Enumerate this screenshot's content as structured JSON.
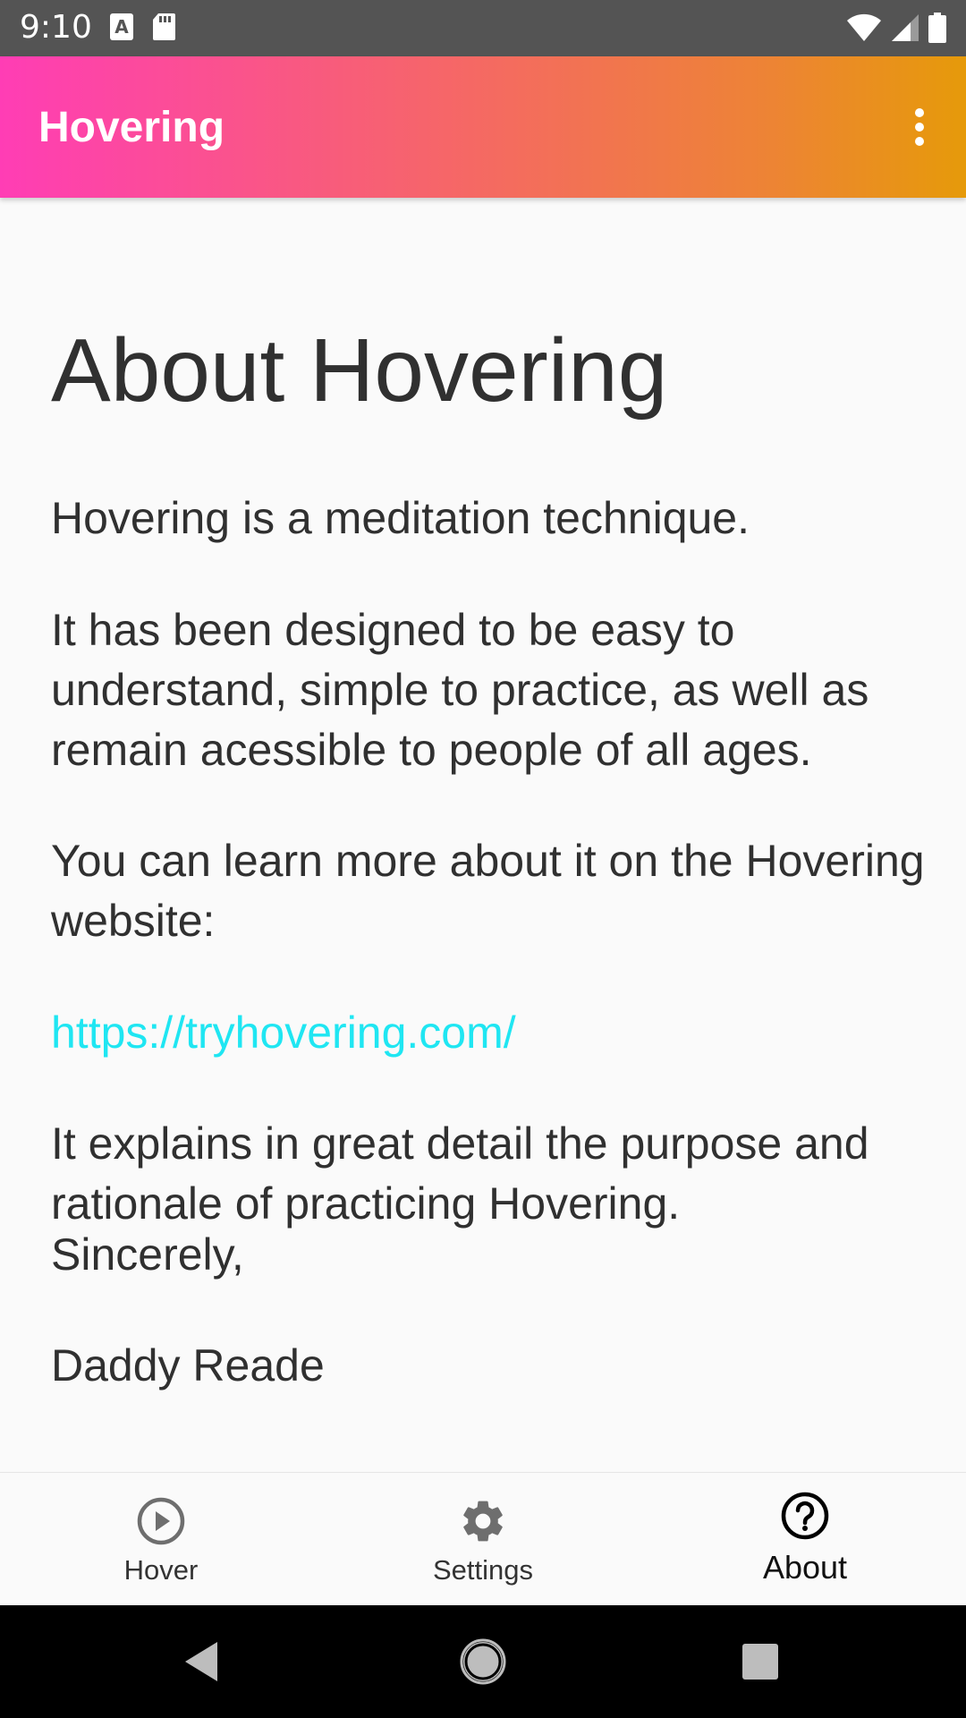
{
  "status_bar": {
    "time": "9:10",
    "icons_left": [
      "text-a-icon",
      "sd-card-icon"
    ],
    "icons_right": [
      "wifi-icon",
      "cell-signal-icon",
      "battery-icon"
    ]
  },
  "app_bar": {
    "title": "Hovering",
    "menu_icon": "more-vert-icon",
    "gradient": [
      "#ff3db5",
      "#f6656a",
      "#ed8434",
      "#e69a0a"
    ]
  },
  "content": {
    "heading": "About Hovering",
    "paragraphs": [
      "Hovering is a meditation technique.",
      "It has been designed to be easy to understand, simple to practice, as well as remain acessible to people of all ages.",
      "You can learn more about it on the Hovering website:",
      "It explains in great detail the purpose and rationale of practicing Hovering.",
      "Sincerely,",
      "Daddy Reade"
    ],
    "link": "https://tryhovering.com/",
    "link_color": "#1fe6f2",
    "text_color": "#303030"
  },
  "bottom_nav": {
    "items": [
      {
        "label": "Hover",
        "icon": "play-circle-icon",
        "selected": false
      },
      {
        "label": "Settings",
        "icon": "gear-icon",
        "selected": false
      },
      {
        "label": "About",
        "icon": "help-circle-icon",
        "selected": true
      }
    ]
  },
  "system_nav": {
    "buttons": [
      "back-icon",
      "home-icon",
      "recents-icon"
    ]
  }
}
